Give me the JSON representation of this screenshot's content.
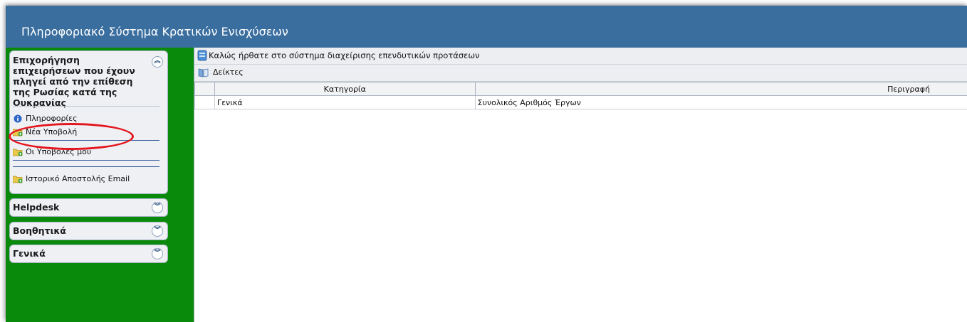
{
  "app": {
    "title": "Πληροφοριακό Σύστημα Κρατικών Ενισχύσεων"
  },
  "sidebar": {
    "main_panel": {
      "title": "Επιχορήγηση επιχειρήσεων που έχουν πληγεί από την επίθεση της Ρωσίας κατά της Ουκρανίας",
      "items": [
        {
          "label": "Πληροφορίες",
          "icon": "info-icon"
        },
        {
          "label": "Νέα Υποβολή",
          "icon": "folder-add-icon"
        },
        {
          "label": "Οι Υποβολές μου",
          "icon": "folder-add-icon"
        },
        {
          "label": "Ιστορικό Αποστολής Email",
          "icon": "folder-add-icon"
        }
      ]
    },
    "panels": [
      {
        "title": "Helpdesk"
      },
      {
        "title": "Βοηθητικά"
      },
      {
        "title": "Γενικά"
      }
    ]
  },
  "content": {
    "welcome": "Καλώς ήρθατε στο σύστημα διαχείρισης επενδυτικών προτάσεων",
    "section": "Δείκτες",
    "table": {
      "columns": [
        "Κατηγορία",
        "Περιγραφή"
      ],
      "rows": [
        [
          "Γενικά",
          "Συνολικός Αριθμός Έργων"
        ]
      ]
    }
  },
  "colors": {
    "titlebar": "#3a6e9f",
    "sidebar": "#0a8a0a",
    "highlight": "#e3151d"
  }
}
